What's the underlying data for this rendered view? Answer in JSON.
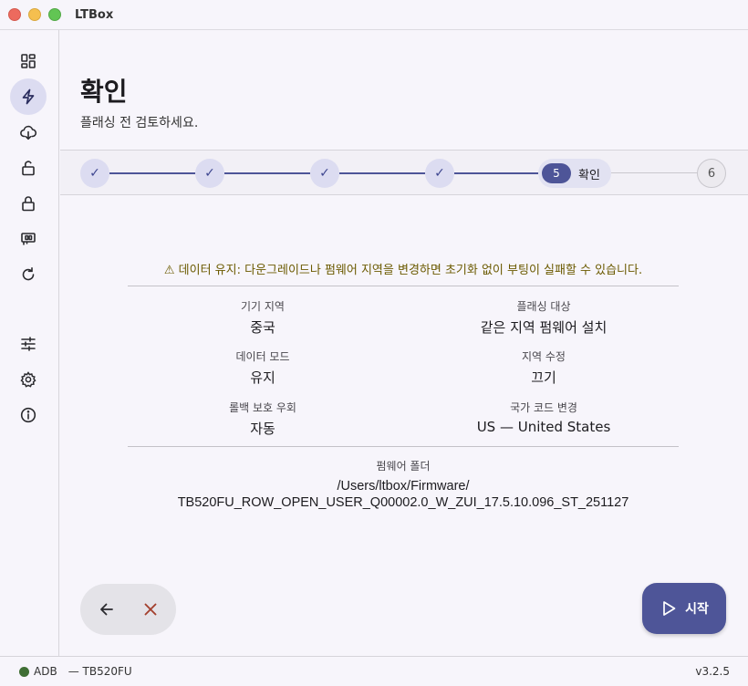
{
  "window": {
    "title": "LTBox"
  },
  "sidebar": {
    "items": [
      {
        "icon": "dashboard-icon"
      },
      {
        "icon": "flash-icon",
        "active": true
      },
      {
        "icon": "cloud-download-icon"
      },
      {
        "icon": "unlock-icon"
      },
      {
        "icon": "lock-icon"
      },
      {
        "icon": "sim-card-icon"
      },
      {
        "icon": "refresh-icon"
      },
      {
        "icon": "tune-icon"
      },
      {
        "icon": "gear-icon"
      },
      {
        "icon": "info-icon"
      }
    ]
  },
  "page": {
    "title": "확인",
    "subtitle": "플래싱 전 검토하세요."
  },
  "stepper": {
    "completed_mark": "✓",
    "active": {
      "number": "5",
      "label": "확인"
    },
    "pending": {
      "number": "6"
    }
  },
  "review": {
    "warning": "⚠ 데이터 유지: 다운그레이드나 펌웨어 지역을 변경하면 초기화 없이 부팅이 실패할 수 있습니다.",
    "device_region": {
      "label": "기기 지역",
      "value": "중국"
    },
    "flash_target": {
      "label": "플래싱 대상",
      "value": "같은 지역 펌웨어 설치"
    },
    "data_mode": {
      "label": "데이터 모드",
      "value": "유지"
    },
    "region_fix": {
      "label": "지역 수정",
      "value": "끄기"
    },
    "rollback": {
      "label": "롤백 보호 우회",
      "value": "자동"
    },
    "country_code": {
      "label": "국가 코드 변경",
      "value": "US — United States"
    },
    "firmware_folder": {
      "label": "펌웨어 폴더",
      "line1": "/Users/ltbox/Firmware/",
      "line2": "TB520FU_ROW_OPEN_USER_Q00002.0_W_ZUI_17.5.10.096_ST_251127"
    }
  },
  "actions": {
    "start_label": "시작"
  },
  "status": {
    "adb": "ADB",
    "device": "— TB520FU",
    "version": "v3.2.5"
  },
  "colors": {
    "accent": "#4e5598",
    "accent_light": "#dcdcf1",
    "warning": "#6b5a00",
    "cancel": "#a3402e",
    "adb_connected": "#3f6e34"
  }
}
